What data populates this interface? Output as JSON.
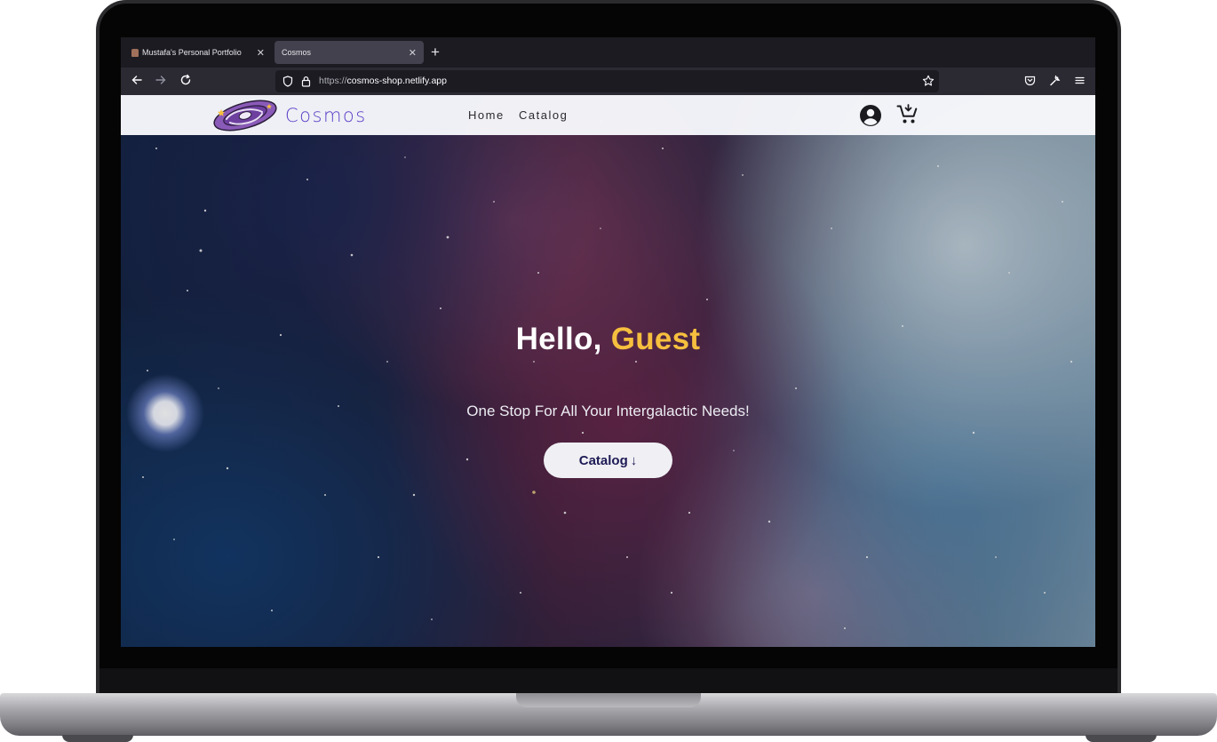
{
  "browser": {
    "tabs": [
      {
        "title": "Mustafa's Personal Portfolio",
        "active": false
      },
      {
        "title": "Cosmos",
        "active": true
      }
    ],
    "new_tab_label": "+",
    "url_protocol": "https://",
    "url_host": "cosmos-shop.netlify.app",
    "icons": [
      "back-icon",
      "forward-icon",
      "reload-icon",
      "shield-icon",
      "lock-icon",
      "bookmark-star-icon",
      "pocket-icon",
      "tools-icon",
      "menu-icon"
    ]
  },
  "site": {
    "brand": "Cosmos",
    "nav": [
      "Home",
      "Catalog"
    ],
    "icons": [
      "account-icon",
      "cart-icon"
    ]
  },
  "hero": {
    "greeting": "Hello,",
    "name": "Guest",
    "subtitle": "One Stop For All Your Intergalactic Needs!",
    "button_label": "Catalog",
    "button_icon": "↓"
  },
  "colors": {
    "brand": "#5b3dc8",
    "accent_name": "#f6bf3e",
    "button_text": "#1d1a55"
  }
}
